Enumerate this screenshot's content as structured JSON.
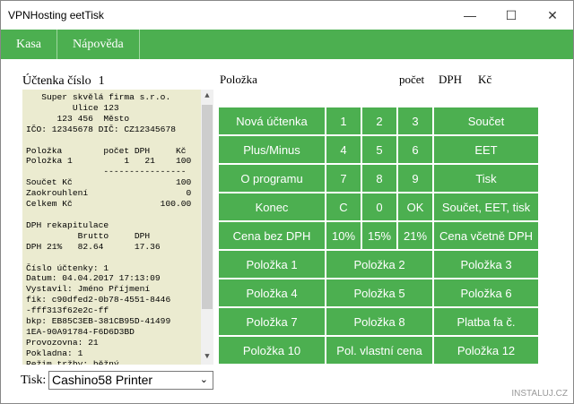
{
  "window": {
    "title": "VPNHosting eetTisk"
  },
  "menu": [
    "Kasa",
    "Nápověda"
  ],
  "receipt": {
    "label": "Účtenka číslo",
    "number": "1",
    "text": "   Super skvělá firma s.r.o.\n         Ulice 123\n      123 456  Město\nIČO: 12345678 DIČ: CZ12345678\n\nPoložka        počet DPH     Kč\nPoložka 1          1   21    100\n               ----------------\nSoučet Kč                    100\nZaokrouhlení                   0\nCelkem Kč                 100.00\n\nDPH rekapitulace\n          Brutto     DPH\nDPH 21%   82.64      17.36\n\nČíslo účtenky: 1\nDatum: 04.04.2017 17:13:09\nVystavil: Jméno Příjmení\nfik: c90dfed2-0b78-4551-8446\n-fff313f62e2c-ff\nbkp: EB85C3EB-381CB95D-41499\n1EA-90A91784-F6D6D3BD\nProvozovna: 21\nPokladna: 1\nRežim tržby: běžný"
  },
  "print": {
    "label": "Tisk:",
    "printer": "Cashino58 Printer"
  },
  "headers": {
    "item": "Položka",
    "count": "počet",
    "vat": "DPH",
    "czk": "Kč"
  },
  "buttons": [
    "Nová účtenka",
    "1",
    "2",
    "3",
    "Součet",
    "Plus/Minus",
    "4",
    "5",
    "6",
    "EET",
    "O programu",
    "7",
    "8",
    "9",
    "Tisk",
    "Konec",
    "C",
    "0",
    "OK",
    "Součet, EET, tisk",
    "Cena bez DPH",
    "10%",
    "15%",
    "21%",
    "Cena včetně DPH",
    "Položka 1",
    "Položka 2",
    "Položka 3",
    "Položka 4",
    "Položka 5",
    "Položka 6",
    "Položka 7",
    "Položka 8",
    "Platba fa č.",
    "Položka 10",
    "Pol. vlastní cena",
    "Položka 12"
  ],
  "watermark": "INSTALUJ.CZ"
}
